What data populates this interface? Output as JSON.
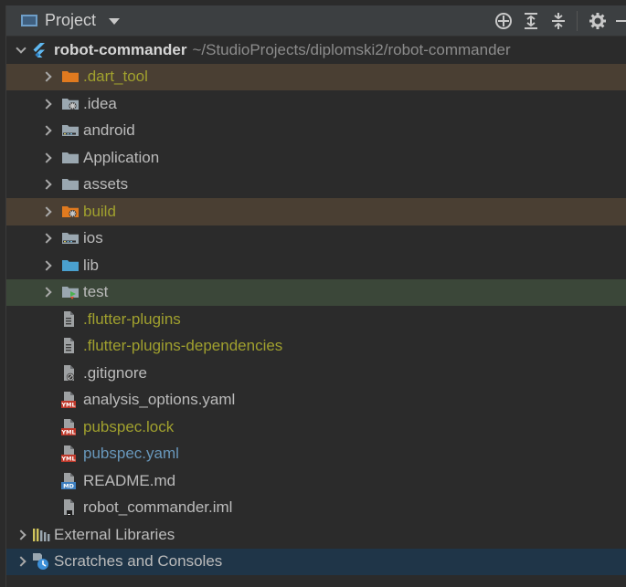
{
  "toolbar": {
    "title": "Project",
    "icons": [
      "locate-icon",
      "expand-all-icon",
      "collapse-all-icon",
      "gear-icon",
      "hide-icon"
    ]
  },
  "tree": {
    "root": {
      "name": "robot-commander",
      "path": "~/StudioProjects/diplomski2/robot-commander"
    },
    "items": [
      {
        "label": ".dart_tool",
        "kind": "folder",
        "expandable": true,
        "color": "olive",
        "highlight": "brown",
        "icon": "folder-orange-icon"
      },
      {
        "label": ".idea",
        "kind": "folder",
        "expandable": true,
        "color": "normal",
        "highlight": "",
        "icon": "folder-settings-icon"
      },
      {
        "label": "android",
        "kind": "folder",
        "expandable": true,
        "color": "normal",
        "highlight": "",
        "icon": "folder-module-icon"
      },
      {
        "label": "Application",
        "kind": "folder",
        "expandable": true,
        "color": "normal",
        "highlight": "",
        "icon": "folder-icon"
      },
      {
        "label": "assets",
        "kind": "folder",
        "expandable": true,
        "color": "normal",
        "highlight": "",
        "icon": "folder-icon"
      },
      {
        "label": "build",
        "kind": "folder",
        "expandable": true,
        "color": "olive",
        "highlight": "brown",
        "icon": "folder-excluded-icon"
      },
      {
        "label": "ios",
        "kind": "folder",
        "expandable": true,
        "color": "normal",
        "highlight": "",
        "icon": "folder-module-icon"
      },
      {
        "label": "lib",
        "kind": "folder",
        "expandable": true,
        "color": "normal",
        "highlight": "",
        "icon": "folder-source-icon"
      },
      {
        "label": "test",
        "kind": "folder",
        "expandable": true,
        "color": "normal",
        "highlight": "green",
        "icon": "folder-test-icon"
      },
      {
        "label": ".flutter-plugins",
        "kind": "file",
        "expandable": false,
        "color": "olive",
        "highlight": "",
        "icon": "text-file-icon"
      },
      {
        "label": ".flutter-plugins-dependencies",
        "kind": "file",
        "expandable": false,
        "color": "olive",
        "highlight": "",
        "icon": "text-file-icon"
      },
      {
        "label": ".gitignore",
        "kind": "file",
        "expandable": false,
        "color": "normal",
        "highlight": "",
        "icon": "ignore-file-icon"
      },
      {
        "label": "analysis_options.yaml",
        "kind": "file",
        "expandable": false,
        "color": "normal",
        "highlight": "",
        "icon": "yaml-file-icon",
        "badge": "YML"
      },
      {
        "label": "pubspec.lock",
        "kind": "file",
        "expandable": false,
        "color": "olive",
        "highlight": "",
        "icon": "yaml-file-icon",
        "badge": "YML"
      },
      {
        "label": "pubspec.yaml",
        "kind": "file",
        "expandable": false,
        "color": "blue",
        "highlight": "",
        "icon": "yaml-file-icon",
        "badge": "YML"
      },
      {
        "label": "README.md",
        "kind": "file",
        "expandable": false,
        "color": "normal",
        "highlight": "",
        "icon": "markdown-file-icon",
        "badge": "MD"
      },
      {
        "label": "robot_commander.iml",
        "kind": "file",
        "expandable": false,
        "color": "normal",
        "highlight": "",
        "icon": "iml-file-icon"
      }
    ],
    "bottom": [
      {
        "label": "External Libraries",
        "icon": "libraries-icon",
        "highlight": ""
      },
      {
        "label": "Scratches and Consoles",
        "icon": "scratches-icon",
        "highlight": "blue"
      }
    ]
  },
  "colors": {
    "background": "#2b2b2b",
    "toolbar": "#3c3f41",
    "text": "#bbbbbb",
    "excluded_text": "#a0a02e",
    "modified_text": "#6897bb",
    "excluded_row": "#4a3f33",
    "test_row": "#3b4739",
    "selected_row": "#1f3548"
  }
}
